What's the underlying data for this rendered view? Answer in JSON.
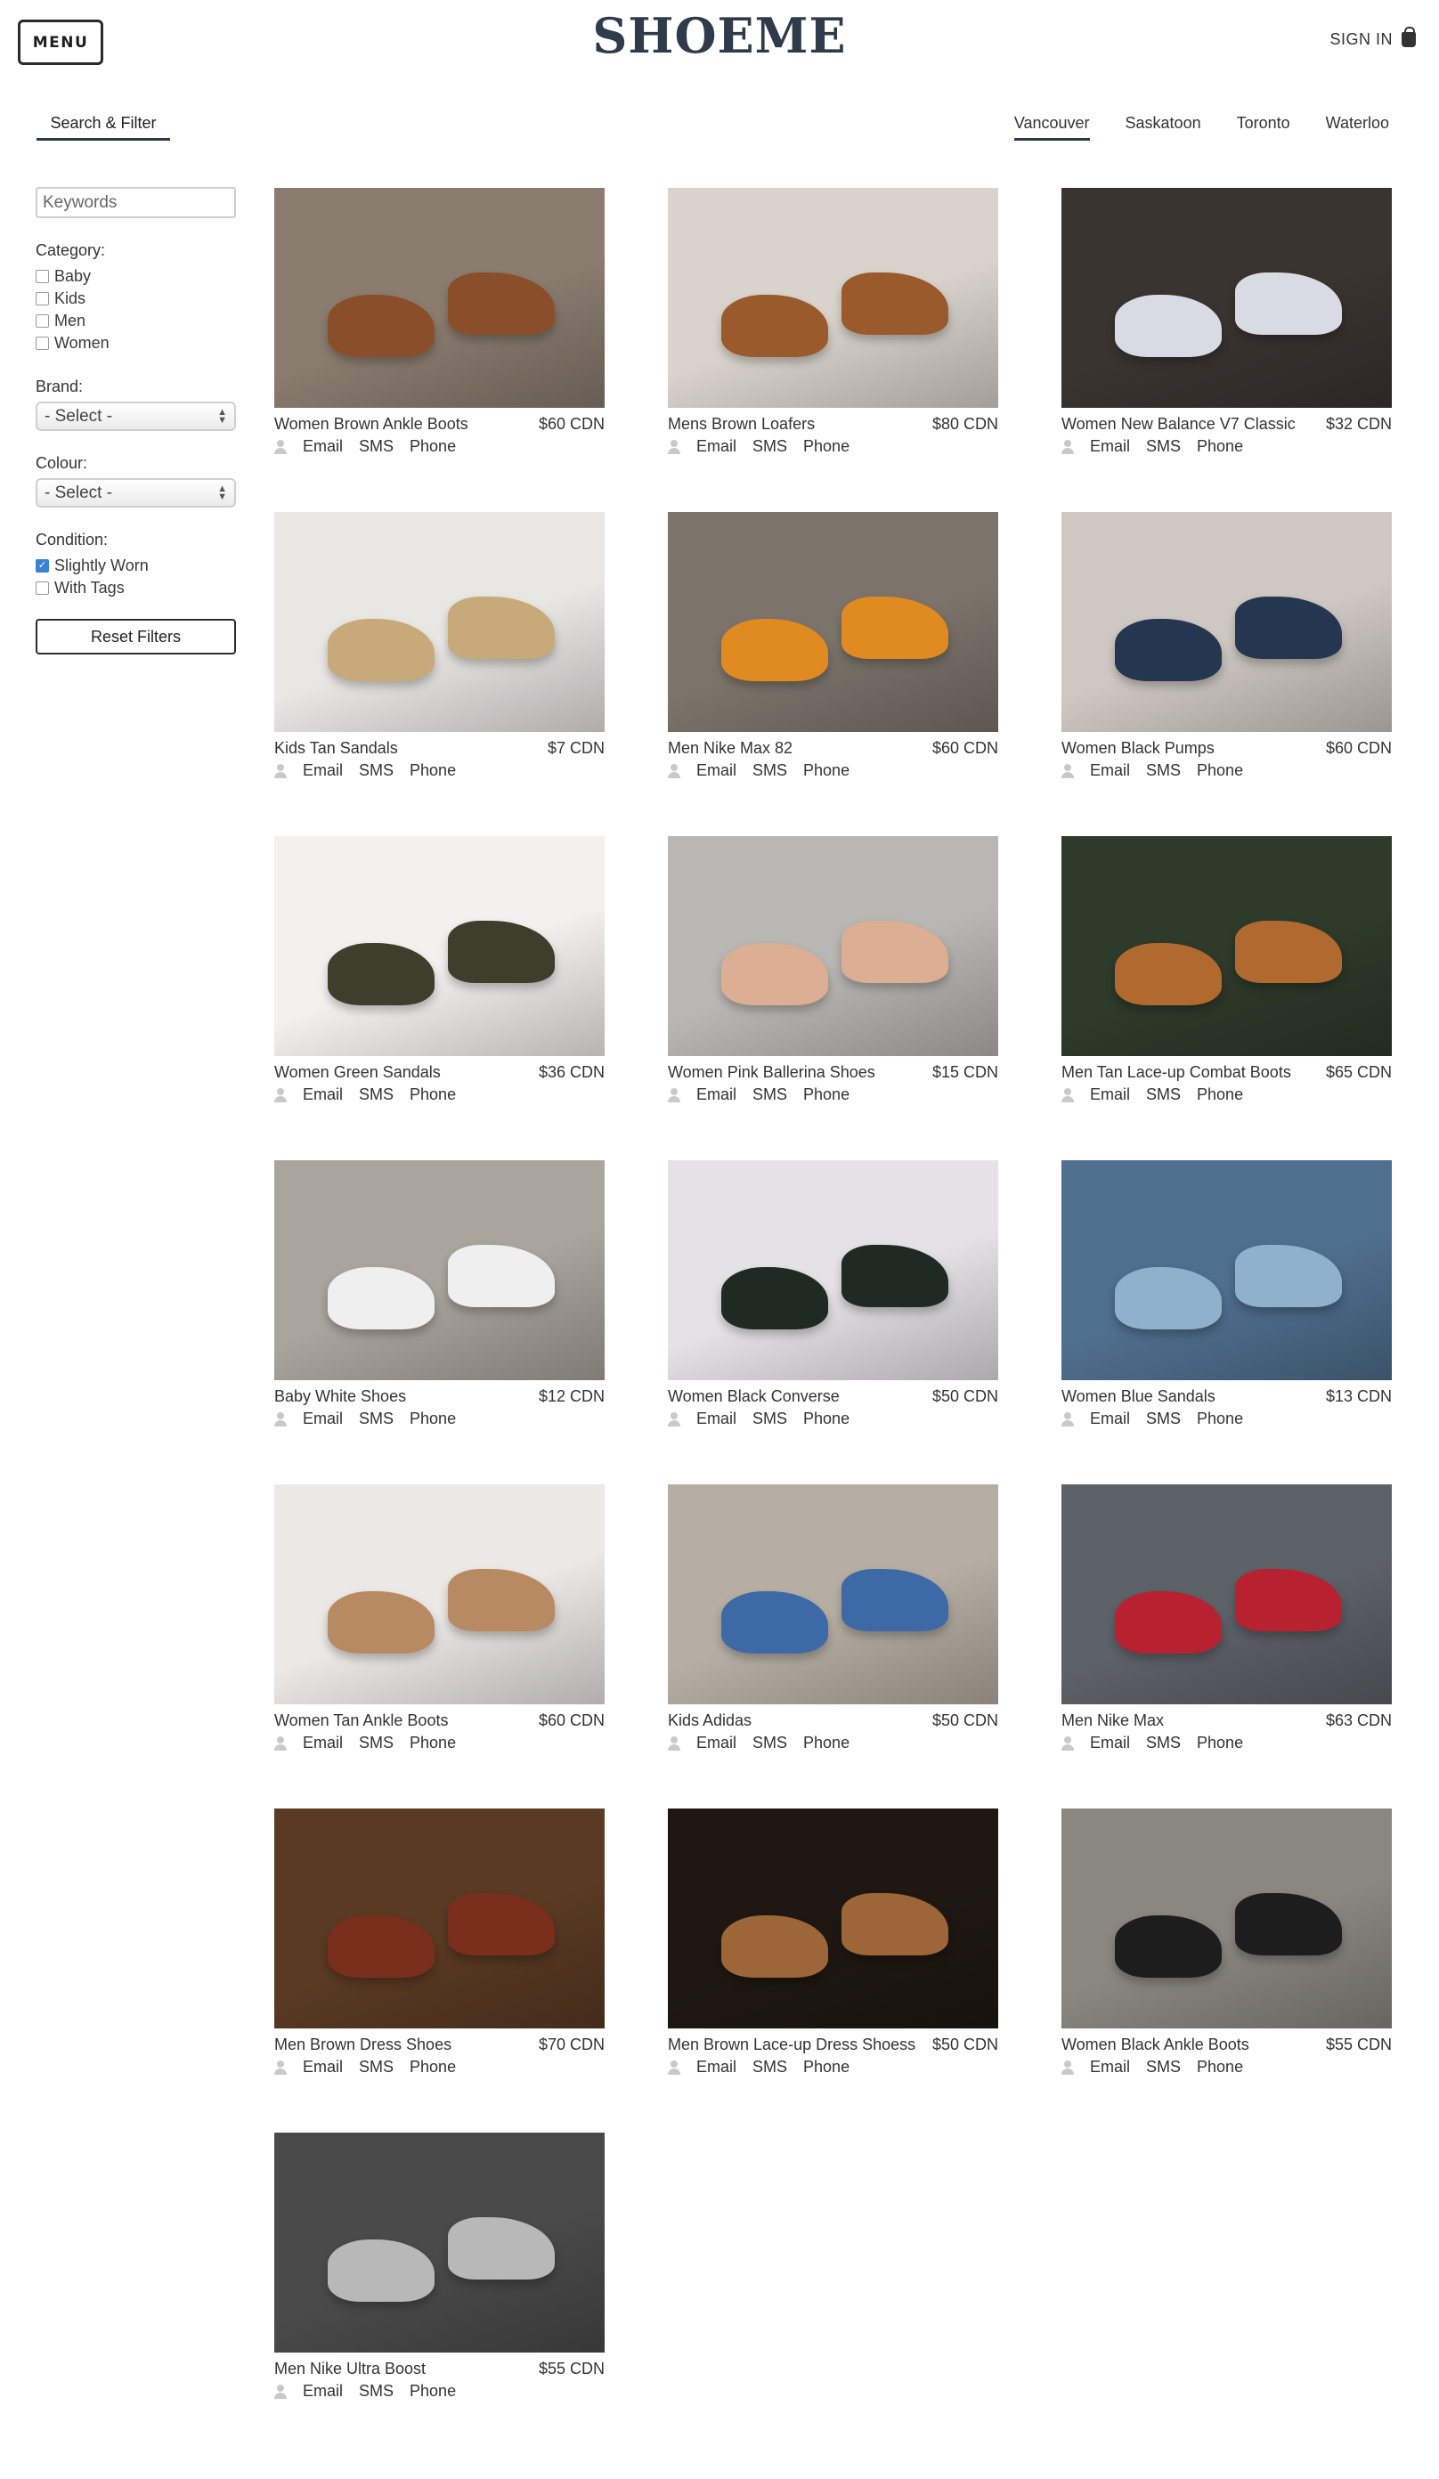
{
  "header": {
    "menu_label": "MENU",
    "brand": "SHOEME",
    "signin_label": "SIGN IN"
  },
  "tabs": {
    "filter_label": "Search & Filter",
    "cities": [
      "Vancouver",
      "Saskatoon",
      "Toronto",
      "Waterloo"
    ],
    "active_city": "Vancouver"
  },
  "sidebar": {
    "keywords_placeholder": "Keywords",
    "category_label": "Category:",
    "categories": [
      {
        "label": "Baby",
        "checked": false
      },
      {
        "label": "Kids",
        "checked": false
      },
      {
        "label": "Men",
        "checked": false
      },
      {
        "label": "Women",
        "checked": false
      }
    ],
    "brand_label": "Brand:",
    "brand_value": "- Select -",
    "colour_label": "Colour:",
    "colour_value": "- Select -",
    "condition_label": "Condition:",
    "conditions": [
      {
        "label": "Slightly Worn",
        "checked": true
      },
      {
        "label": "With Tags",
        "checked": false
      }
    ],
    "reset_label": "Reset Filters"
  },
  "contact_labels": {
    "email": "Email",
    "sms": "SMS",
    "phone": "Phone"
  },
  "products": [
    {
      "title": "Women Brown Ankle Boots",
      "price": "$60 CDN",
      "bg": "#8a7c6f",
      "shoe": "#8a4f2a"
    },
    {
      "title": "Mens Brown Loafers",
      "price": "$80 CDN",
      "bg": "#d9d3cc",
      "shoe": "#9a5a2c"
    },
    {
      "title": "Women New Balance V7 Classic",
      "price": "$32 CDN",
      "bg": "#3a3430",
      "shoe": "#d8dbe4"
    },
    {
      "title": "Kids Tan Sandals",
      "price": "$7 CDN",
      "bg": "#e9e7e4",
      "shoe": "#c8a97a"
    },
    {
      "title": "Men Nike Max 82",
      "price": "$60 CDN",
      "bg": "#7c746b",
      "shoe": "#e08a22"
    },
    {
      "title": "Women Black Pumps",
      "price": "$60 CDN",
      "bg": "#cfc8c2",
      "shoe": "#243650"
    },
    {
      "title": "Women Green Sandals",
      "price": "$36 CDN",
      "bg": "#f2f1ef",
      "shoe": "#3d3f2c"
    },
    {
      "title": "Women Pink Ballerina Shoes",
      "price": "$15 CDN",
      "bg": "#b9b7b3",
      "shoe": "#dcae94"
    },
    {
      "title": "Men Tan Lace-up Combat Boots",
      "price": "$65 CDN",
      "bg": "#2e3a2a",
      "shoe": "#b06a30"
    },
    {
      "title": "Baby White Shoes",
      "price": "$12 CDN",
      "bg": "#a9a49c",
      "shoe": "#efefef"
    },
    {
      "title": "Women Black Converse",
      "price": "$50 CDN",
      "bg": "#e4e2e4",
      "shoe": "#1f2a22"
    },
    {
      "title": "Women Blue Sandals",
      "price": "$13 CDN",
      "bg": "#4f6f8e",
      "shoe": "#8fb1cc"
    },
    {
      "title": "Women Tan Ankle Boots",
      "price": "$60 CDN",
      "bg": "#ebe8e5",
      "shoe": "#b88a64"
    },
    {
      "title": "Kids Adidas",
      "price": "$50 CDN",
      "bg": "#b6aea3",
      "shoe": "#3d6aa6"
    },
    {
      "title": "Men Nike Max",
      "price": "$63 CDN",
      "bg": "#5d6168",
      "shoe": "#b82230"
    },
    {
      "title": "Men Brown Dress Shoes",
      "price": "$70 CDN",
      "bg": "#5a3a23",
      "shoe": "#7a2f1c"
    },
    {
      "title": "Men Brown Lace-up Dress Shoess",
      "price": "$50 CDN",
      "bg": "#1f1812",
      "shoe": "#9c6638"
    },
    {
      "title": "Women Black Ankle Boots",
      "price": "$55 CDN",
      "bg": "#8a8781",
      "shoe": "#1d1d1d"
    },
    {
      "title": "Men Nike Ultra Boost",
      "price": "$55 CDN",
      "bg": "#4a4a4a",
      "shoe": "#b8b8b8"
    }
  ]
}
